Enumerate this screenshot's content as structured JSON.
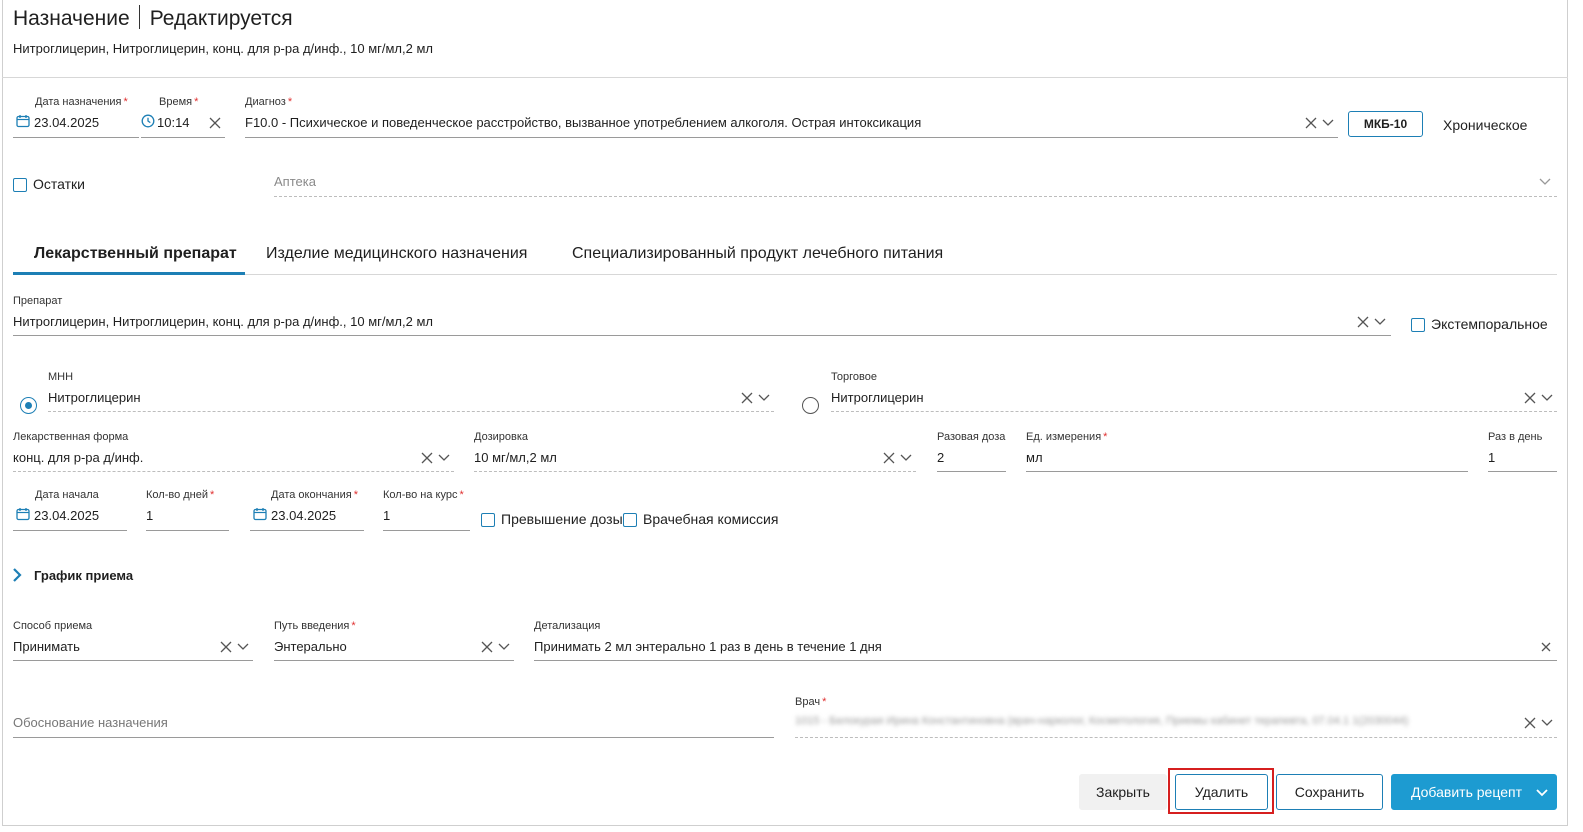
{
  "header": {
    "title": "Назначение",
    "status": "Редактируется",
    "subtitle": "Нитроглицерин, Нитроглицерин, конц. для р-ра д/инф., 10 мг/мл,2 мл"
  },
  "top_row": {
    "date_label": "Дата назначения",
    "date_value": "23.04.2025",
    "time_label": "Время",
    "time_value": "10:14",
    "diagnosis_label": "Диагноз",
    "diagnosis_value": "F10.0 - Психическое и поведенческое расстройство, вызванное употреблением алкоголя. Острая интоксикация",
    "mkb_button": "МКБ-10",
    "chronic_label": "Хроническое"
  },
  "remains": {
    "checkbox_label": "Остатки",
    "pharmacy_placeholder": "Аптека"
  },
  "tabs": [
    {
      "label": "Лекарственный препарат",
      "active": true
    },
    {
      "label": "Изделие медицинского назначения",
      "active": false
    },
    {
      "label": "Специализированный продукт лечебного питания",
      "active": false
    }
  ],
  "drug": {
    "label": "Препарат",
    "value": "Нитроглицерин, Нитроглицерин, конц. для р-ра д/инф., 10 мг/мл,2 мл",
    "extemporal_label": "Экстемпоральное"
  },
  "names": {
    "mnn_label": "МНН",
    "mnn_value": "Нитроглицерин",
    "trade_label": "Торговое",
    "trade_value": "Нитроглицерин",
    "selected": "МНН"
  },
  "dosage": {
    "form_label": "Лекарственная форма",
    "form_value": "конц. для р-ра д/инф.",
    "dose_label": "Дозировка",
    "dose_value": "10 мг/мл,2 мл",
    "single_dose_label": "Разовая доза",
    "single_dose_value": "2",
    "unit_label": "Ед. измерения",
    "unit_value": "мл",
    "per_day_label": "Раз в день",
    "per_day_value": "1"
  },
  "course": {
    "start_label": "Дата начала",
    "start_value": "23.04.2025",
    "days_label": "Кол-во дней",
    "days_value": "1",
    "end_label": "Дата окончания",
    "end_value": "23.04.2025",
    "per_course_label": "Кол-во на курс",
    "per_course_value": "1",
    "overdose_label": "Превышение дозы",
    "commission_label": "Врачебная комиссия"
  },
  "schedule": {
    "section_label": "График приема"
  },
  "intake": {
    "method_label": "Способ приема",
    "method_value": "Принимать",
    "route_label": "Путь введения",
    "route_value": "Энтерально",
    "detail_label": "Детализация",
    "detail_value": "Принимать 2 мл энтерально 1 раз в день в течение 1 дня"
  },
  "justification": {
    "placeholder": "Обоснование назначения",
    "doctor_label": "Врач",
    "doctor_value": "1015 - Белокурая Ирина Константиновна (врач-нарколог, Косметология, Приемы кабинет терапевта, 07.04.1 1(2030044)"
  },
  "footer": {
    "close_label": "Закрыть",
    "delete_label": "Удалить",
    "save_label": "Сохранить",
    "add_recipe_label": "Добавить рецепт"
  },
  "colors": {
    "accent": "#1d7fb5",
    "primary_button": "#1d9bd1",
    "required": "#e03030",
    "highlight": "#d61f1f"
  }
}
